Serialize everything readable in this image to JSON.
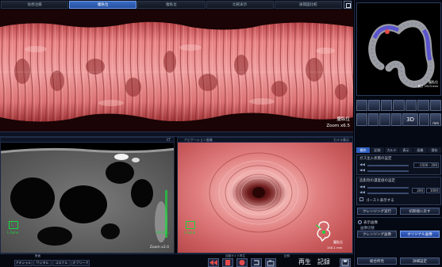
{
  "tabs": [
    {
      "label": "仮想注腸",
      "active": false
    },
    {
      "label": "腹臥位",
      "active": true
    },
    {
      "label": "腹臥位",
      "active": false
    },
    {
      "label": "比較表示",
      "active": false
    },
    {
      "label": "展開図比較",
      "active": false
    }
  ],
  "unfold_view": {
    "position_label": "腹臥位",
    "zoom_label": "Zoom x6.5"
  },
  "ct_view": {
    "header_right": "CT",
    "zoom_label": "Zoom x2.0",
    "marker_label": "L",
    "marker_sub": "L-Gone",
    "scale_label": "100 mm"
  },
  "endo_view": {
    "header_left": "ナビゲーション画像",
    "header_right": "カメラ表示",
    "marker_label": "L",
    "marker_sub": "L-Gone",
    "corner_caption": "腹臥位",
    "corner_sub": "150.1 mm"
  },
  "bottom_bar": {
    "small_caption": "断面",
    "view_buttons": [
      "アキシャル",
      "サジタル",
      "コロナル",
      "オブリーク"
    ],
    "center_caption": "自動ガイド再生",
    "right_caption": "記録",
    "play_label": "再生",
    "record_label": "記録"
  },
  "right_panel": {
    "model_caption": "腹臥位",
    "model_sub": "長さ 1523 mm",
    "icon_labels": [
      "3D",
      "mm"
    ],
    "mode_tabs": [
      "操作",
      "記録",
      "カルテ",
      "表示",
      "画像",
      "保存"
    ],
    "section1_title": "ガス注入状態の設定",
    "section1_value": "-1500 - 200",
    "section2_title": "造影剤の濃度値の設定",
    "section2_val_a": "200",
    "section2_val_b": "1000",
    "checkbox_label": "ゴースト表示する",
    "btn_cleansing": "クレンジング実行",
    "btn_reset": "初期値に戻す",
    "radio_title": "表示画像",
    "radio_sub": "画像切替",
    "btn_cleansed": "クレンジング画像",
    "btn_original": "オリジナル画像",
    "footer_btn_1": "総合所見",
    "footer_btn_2": "詳細設定"
  },
  "colors": {
    "accent": "#2f5fc0",
    "mucosa": "#d96a6c",
    "marker_green": "#1bd63a"
  }
}
